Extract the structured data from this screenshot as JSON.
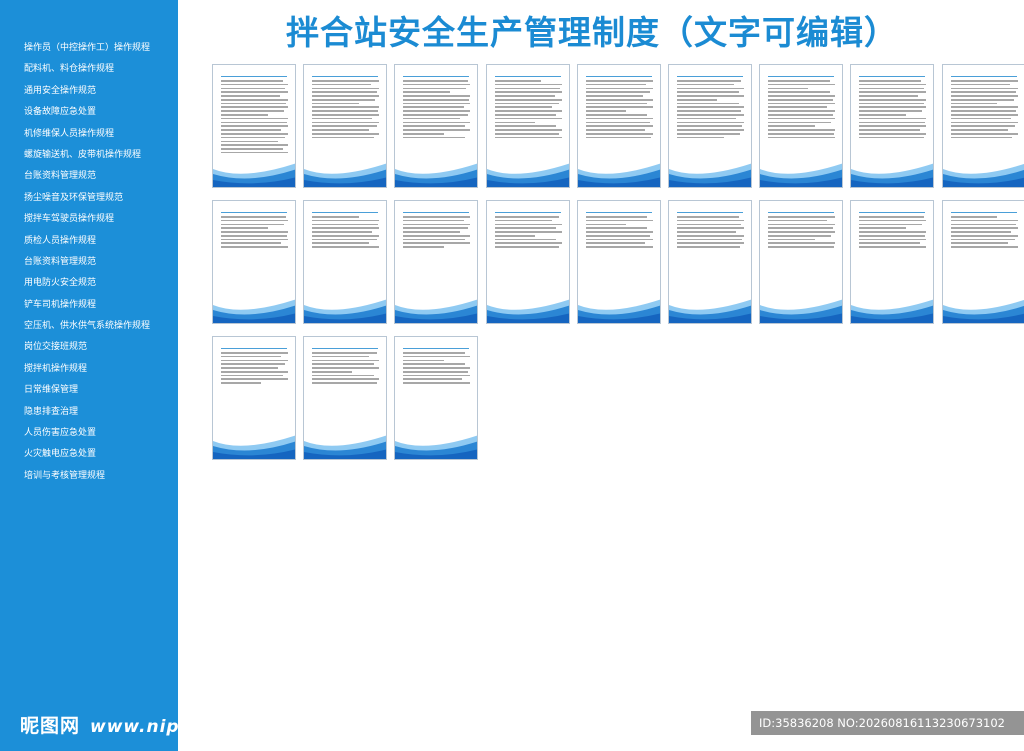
{
  "title": "拌合站安全生产管理制度（文字可编辑）",
  "sidebar": {
    "items": [
      "操作员（中控操作工）操作规程",
      "配料机、料仓操作规程",
      "通用安全操作规范",
      "设备故障应急处置",
      "机修维保人员操作规程",
      "螺旋输送机、皮带机操作规程",
      "台账资料管理规范",
      "扬尘噪音及环保管理规范",
      "搅拌车驾驶员操作规程",
      "质检人员操作规程",
      "台账资料管理规范",
      "用电防火安全规范",
      "铲车司机操作规程",
      "空压机、供水供气系统操作规程",
      "岗位交接班规范",
      "搅拌机操作规程",
      "日常维保管理",
      "隐患排查治理",
      "人员伤害应急处置",
      "火灾触电应急处置",
      "培训与考核管理规程"
    ]
  },
  "cards": {
    "rows": [
      9,
      9,
      3
    ]
  },
  "watermark": {
    "site": "昵图网",
    "url": "www.nipic.com"
  },
  "image_id": "ID:35836208 NO:20260816113230673102",
  "colors": {
    "sidebar": "#1c8fd8",
    "title": "#1b8bd3",
    "wave_dark": "#1565c0",
    "wave_light": "#5fb4ec"
  }
}
